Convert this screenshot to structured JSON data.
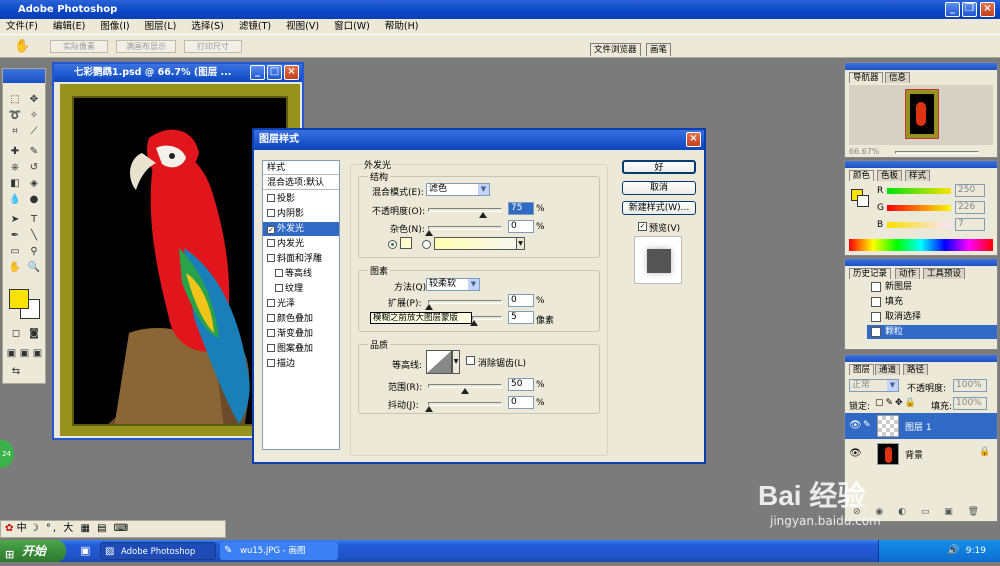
{
  "app": {
    "title": "Adobe Photoshop"
  },
  "menu": [
    "文件(F)",
    "编辑(E)",
    "图像(I)",
    "图层(L)",
    "选择(S)",
    "滤镜(T)",
    "视图(V)",
    "窗口(W)",
    "帮助(H)"
  ],
  "options_bar": {
    "buttons": [
      "实际像素",
      "满画布显示",
      "打印尺寸"
    ],
    "palette_well_tabs": [
      "文件浏览器",
      "画笔"
    ]
  },
  "document": {
    "title": "七彩鹦鹉1.psd @ 66.7% (图层 ..."
  },
  "dialog": {
    "title": "图层样式",
    "style_list": [
      {
        "label": "样式",
        "type": "header"
      },
      {
        "label": "混合选项:默认",
        "type": "header"
      },
      {
        "label": "投影",
        "checked": false
      },
      {
        "label": "内阴影",
        "checked": false
      },
      {
        "label": "外发光",
        "checked": true,
        "selected": true
      },
      {
        "label": "内发光",
        "checked": false
      },
      {
        "label": "斜面和浮雕",
        "checked": false
      },
      {
        "label": "等高线",
        "checked": false,
        "indent": true
      },
      {
        "label": "纹理",
        "checked": false,
        "indent": true
      },
      {
        "label": "光泽",
        "checked": false
      },
      {
        "label": "颜色叠加",
        "checked": false
      },
      {
        "label": "渐变叠加",
        "checked": false
      },
      {
        "label": "图案叠加",
        "checked": false
      },
      {
        "label": "描边",
        "checked": false
      }
    ],
    "section_title": "外发光",
    "structure": {
      "label": "结构",
      "blend_mode_label": "混合模式(E):",
      "blend_mode_value": "滤色",
      "opacity_label": "不透明度(O):",
      "opacity_value": "75",
      "noise_label": "杂色(N):",
      "noise_value": "0",
      "unit": "%"
    },
    "elements": {
      "label": "图素",
      "method_label": "方法(Q):",
      "method_value": "较柔软",
      "spread_label": "扩展(P):",
      "spread_value": "0",
      "size_tooltip": "模糊之前放大图层蒙版",
      "size_value": "5",
      "size_unit": "像素",
      "unit": "%"
    },
    "quality": {
      "label": "品质",
      "contour_label": "等高线:",
      "antialias_label": "消除锯齿(L)",
      "range_label": "范围(R):",
      "range_value": "50",
      "jitter_label": "抖动(J):",
      "jitter_value": "0",
      "unit": "%"
    },
    "buttons": {
      "ok": "好",
      "cancel": "取消",
      "new_style": "新建样式(W)...",
      "preview": "预览(V)"
    },
    "levels": {
      "opacity": 0.75,
      "noise": 0.0,
      "spread": 0.0,
      "size": 0.04,
      "range": 0.5,
      "jitter": 0.0
    }
  },
  "navigator": {
    "tabs": [
      "导航器",
      "信息"
    ],
    "zoom": "66.67%"
  },
  "color_panel": {
    "tabs": [
      "颜色",
      "色板",
      "样式"
    ],
    "channels": [
      {
        "name": "R",
        "value": "250",
        "level": 0.98
      },
      {
        "name": "G",
        "value": "226",
        "level": 0.89
      },
      {
        "name": "B",
        "value": "7",
        "level": 0.03
      }
    ],
    "foreground": "#fae207"
  },
  "history_panel": {
    "tabs": [
      "历史记录",
      "动作",
      "工具预设"
    ],
    "items": [
      {
        "label": "新图层",
        "selected": false
      },
      {
        "label": "填充",
        "selected": false
      },
      {
        "label": "取消选择",
        "selected": false
      },
      {
        "label": "颗粒",
        "selected": true
      }
    ]
  },
  "layers_panel": {
    "tabs": [
      "图层",
      "通道",
      "路径"
    ],
    "blend_mode": "正常",
    "opacity_label": "不透明度:",
    "opacity_value": "100%",
    "lock_label": "锁定:",
    "fill_label": "填充:",
    "fill_value": "100%",
    "layers": [
      {
        "name": "图层 1",
        "selected": true
      },
      {
        "name": "背景",
        "selected": false
      }
    ]
  },
  "ime_bar": "中",
  "taskbar": {
    "start": "开始",
    "items": [
      "Adobe Photoshop",
      "wu15.JPG - 画图"
    ],
    "time": "9:19"
  },
  "watermark": {
    "brand": "Bai 经验",
    "url": "jingyan.baidu.com"
  },
  "colors": {
    "accent": "#316ac5",
    "titlebar": "#0a46c7",
    "foreground_swatch": "#fae207"
  }
}
